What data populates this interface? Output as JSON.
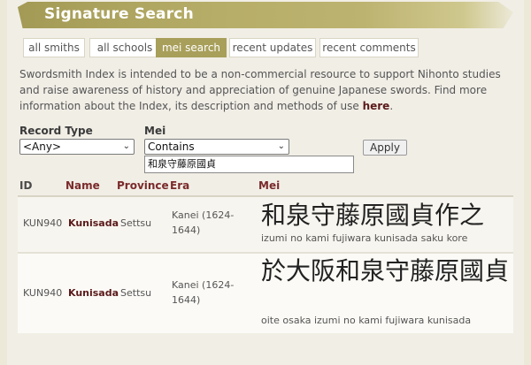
{
  "header": {
    "title": "Signature Search"
  },
  "tabs": [
    {
      "label": "all smiths",
      "active": false
    },
    {
      "label": "all schools",
      "active": false
    },
    {
      "label": "mei search",
      "active": true
    },
    {
      "label": "recent updates",
      "active": false
    },
    {
      "label": "recent comments",
      "active": false
    }
  ],
  "intro": {
    "text": "Swordsmith Index is intended to be a non-commercial resource to support Nihonto studies and raise awareness of history and appreciation of genuine Japanese swords. Find more information about the Index, its description and methods of use ",
    "link": "here",
    "suffix": "."
  },
  "filters": {
    "record_type_label": "Record Type",
    "record_type_value": "<Any>",
    "mei_label": "Mei",
    "mei_mode_value": "Contains",
    "mei_query_value": "和泉守藤原國貞",
    "apply_label": "Apply"
  },
  "table": {
    "columns": [
      "ID",
      "Name",
      "Province",
      "Era",
      "Mei"
    ],
    "rows": [
      {
        "id": "KUN940",
        "name": "Kunisada",
        "province": "Settsu",
        "era": "Kanei (1624-1644)",
        "mei_kanji": "和泉守藤原國貞作之",
        "mei_romaji": "izumi no kami fujiwara kunisada saku kore"
      },
      {
        "id": "KUN940",
        "name": "Kunisada",
        "province": "Settsu",
        "era": "Kanei (1624-1644)",
        "mei_kanji": "於大阪和泉守藤原國貞",
        "mei_romaji": "oite osaka izumi no kami fujiwara kunisada"
      }
    ]
  },
  "colors": {
    "banner": "#a89f5b",
    "active_tab": "#a89f5b",
    "column_heading": "#7a2a2a",
    "name_link": "#5a1a1a",
    "page_bg": "#ece9d8"
  }
}
